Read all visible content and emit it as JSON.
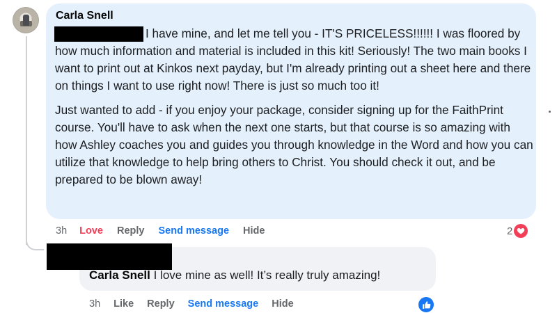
{
  "comment": {
    "author": "Carla Snell",
    "paragraph1": "I have mine, and let me tell you - IT'S PRICELESS!!!!!! I was floored by how much information and material is included in this kit! Seriously! The two main books I want to print out at Kinkos next payday, but I'm already printing out a sheet here and there on things I want to use right now! There is just so much too it!",
    "paragraph2": "Just wanted to add - if you enjoy your package, consider signing up for the FaithPrint course. You'll have to ask when the next one starts, but that course is so amazing with how Ashley coaches you and guides you through knowledge in the Word and how you can utilize that knowledge to help bring others to Christ. You should check it out, and be prepared to be blown away!",
    "actions": {
      "time": "3h",
      "reaction": "Love",
      "reply": "Reply",
      "send": "Send message",
      "hide": "Hide"
    },
    "reaction_count": "2",
    "reaction_icon": "heart-icon",
    "colors": {
      "love": "#f33e58",
      "link": "#1877f2",
      "bubble": "#e4f0fb"
    }
  },
  "reply": {
    "author": "Carla Snell",
    "text": "I love mine as well! It’s really truly amazing!",
    "actions": {
      "time": "3h",
      "like": "Like",
      "reply": "Reply",
      "send": "Send message",
      "hide": "Hide"
    },
    "reaction_icon": "like-icon"
  }
}
